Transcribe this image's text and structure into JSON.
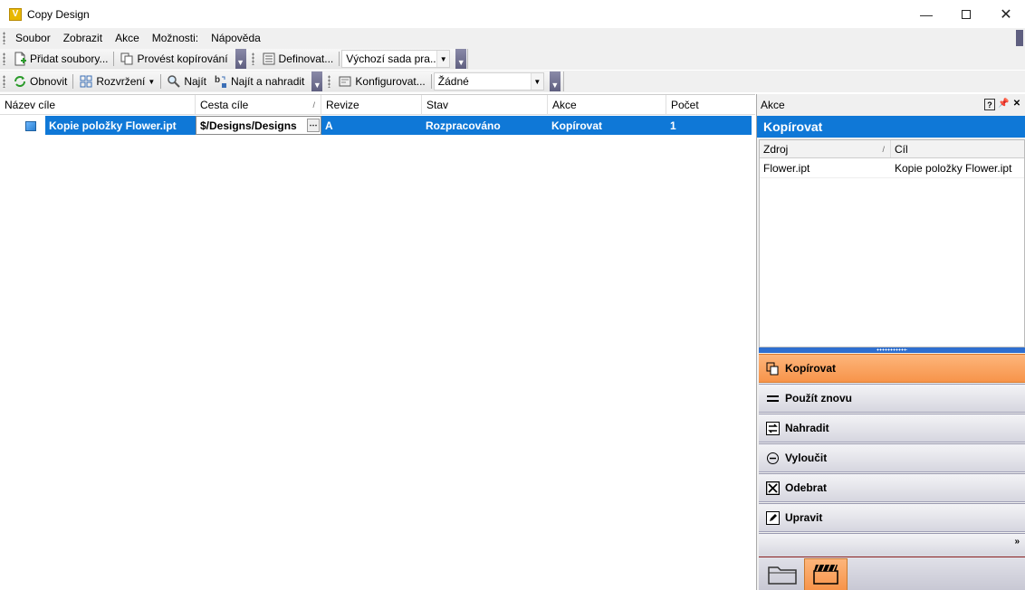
{
  "window": {
    "title": "Copy Design",
    "app_icon": "V"
  },
  "menu": [
    "Soubor",
    "Zobrazit",
    "Akce",
    "Možnosti:",
    "Nápověda"
  ],
  "toolbar1": {
    "add_files": "Přidat soubory...",
    "copy": "Provést kopírování",
    "define": "Definovat...",
    "default_set": "Výchozí sada pra..."
  },
  "toolbar2": {
    "refresh": "Obnovit",
    "layout": "Rozvržení",
    "find": "Najít",
    "find_replace": "Najít a nahradit",
    "configure": "Konfigurovat...",
    "filter": "Žádné"
  },
  "grid": {
    "columns": [
      "Název cíle",
      "Cesta cíle",
      "Revize",
      "Stav",
      "Akce",
      "Počet"
    ],
    "rows": [
      {
        "name": "Kopie položky Flower.ipt",
        "path": "$/Designs/Designs",
        "revision": "A",
        "state": "Rozpracováno",
        "action": "Kopírovat",
        "count": "1"
      }
    ]
  },
  "panel": {
    "title": "Akce",
    "heading": "Kopírovat",
    "table_columns": [
      "Zdroj",
      "Cíl"
    ],
    "table_rows": [
      {
        "source": "Flower.ipt",
        "target": "Kopie položky Flower.ipt"
      }
    ],
    "actions": [
      "Kopírovat",
      "Použít znovu",
      "Nahradit",
      "Vyloučit",
      "Odebrat",
      "Upravit"
    ],
    "active_action": "Kopírovat"
  },
  "colors": {
    "selection": "#0f78d7",
    "active_orange": "#f7944a"
  }
}
